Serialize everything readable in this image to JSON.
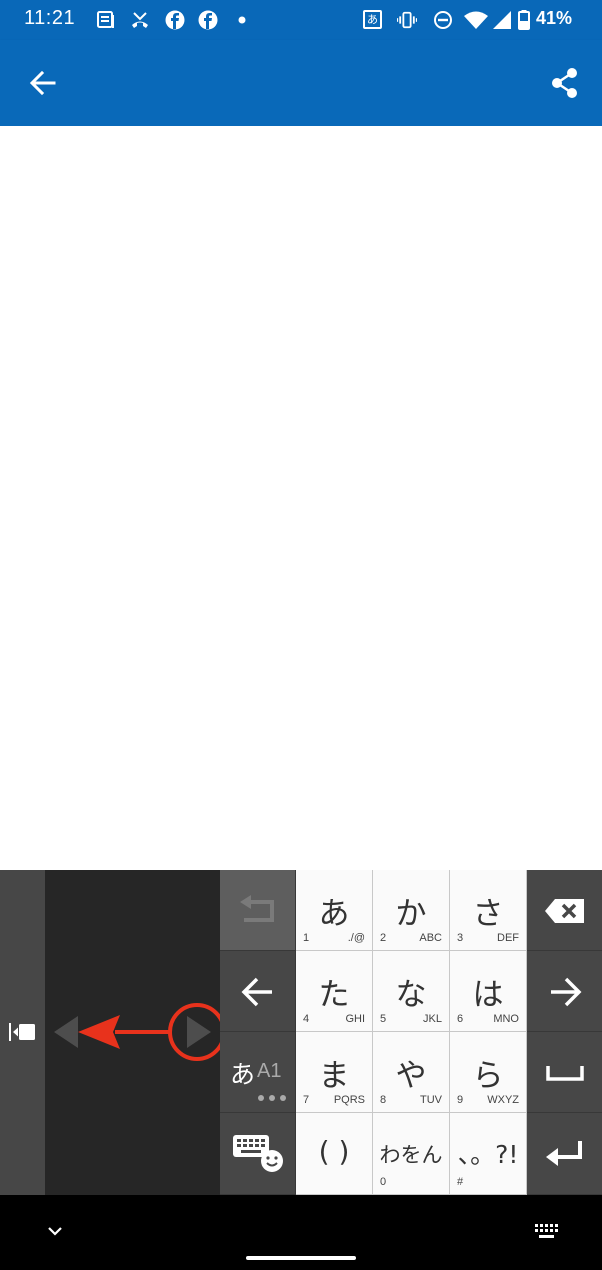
{
  "status_bar": {
    "time": "11:21",
    "battery": "41%",
    "ime_indicator": "あ",
    "icons": [
      "news-icon",
      "missed-call-icon",
      "facebook-icon",
      "facebook-icon",
      "dot-icon",
      "ime-icon",
      "vibrate-icon",
      "dnd-icon",
      "wifi-icon",
      "signal-icon",
      "battery-icon"
    ]
  },
  "app_bar": {
    "color": "#0969b9",
    "left_icon": "back-arrow-icon",
    "right_icon": "share-icon"
  },
  "keyboard": {
    "side_icon": "keyboard-dock-icon",
    "cursor_left_icon": "triangle-left-icon",
    "cursor_right_icon": "triangle-right-icon",
    "annotation_color": "#e8321c",
    "keys": [
      {
        "kana": "あ",
        "num": "1",
        "sub": "./@"
      },
      {
        "kana": "か",
        "num": "2",
        "sub": "ABC"
      },
      {
        "kana": "さ",
        "num": "3",
        "sub": "DEF"
      },
      {
        "kana": "た",
        "num": "4",
        "sub": "GHI"
      },
      {
        "kana": "な",
        "num": "5",
        "sub": "JKL"
      },
      {
        "kana": "は",
        "num": "6",
        "sub": "MNO"
      },
      {
        "kana": "ま",
        "num": "7",
        "sub": "PQRS"
      },
      {
        "kana": "や",
        "num": "8",
        "sub": "TUV"
      },
      {
        "kana": "ら",
        "num": "9",
        "sub": "WXYZ"
      },
      {
        "kana": "( )",
        "num": "",
        "sub": ""
      },
      {
        "kana": "わをん",
        "num": "0",
        "sub": ""
      },
      {
        "kana": "、。?!",
        "num": "#",
        "sub": ""
      }
    ],
    "mode_key": {
      "kana": "あ",
      "latin": "A1"
    }
  }
}
